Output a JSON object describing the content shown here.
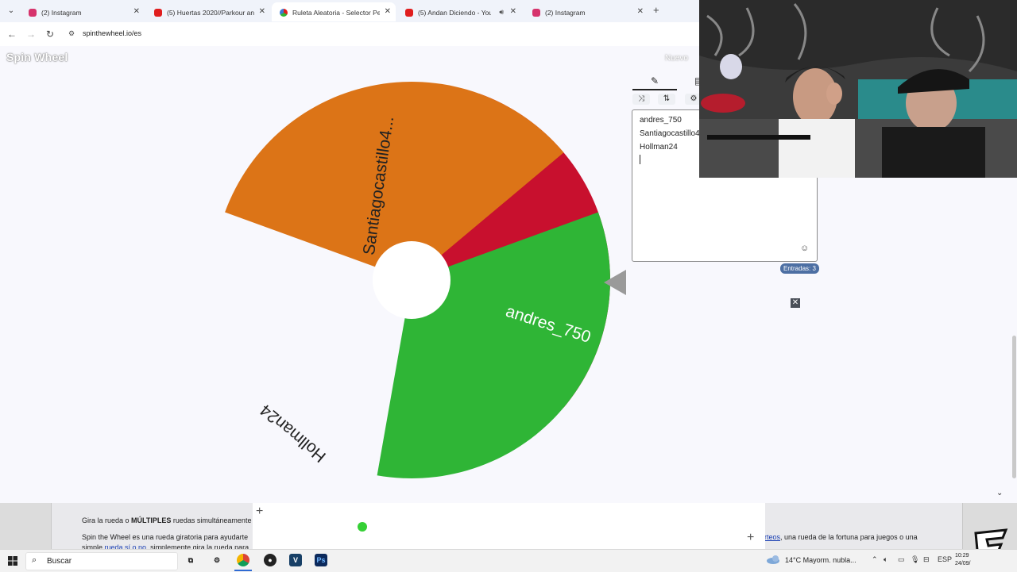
{
  "browser": {
    "tabs": [
      {
        "title": "(2) Instagram",
        "favicon": "instagram-icon",
        "color": "#d6336c"
      },
      {
        "title": "(5) Huertas 2020//Parkour and",
        "favicon": "youtube-icon",
        "color": "#e01e1e"
      },
      {
        "title": "Ruleta Aleatoria - Selector Pers",
        "favicon": "wheel-favicon",
        "color": "#3a7bd5",
        "active": true
      },
      {
        "title": "(5) Andan Diciendo - YouTu",
        "favicon": "youtube-icon",
        "color": "#e01e1e",
        "playing_audio": true
      },
      {
        "title": "(2) Instagram",
        "favicon": "instagram-icon",
        "color": "#d6336c"
      }
    ],
    "url": "spinthewheel.io/es"
  },
  "header": {
    "logo": "Spin Wheel",
    "new_button": "Nuevo"
  },
  "wheel": {
    "segments": [
      {
        "label": "andres_750",
        "color": "#c8102e"
      },
      {
        "label": "Hollman24",
        "color": "#2fb536"
      },
      {
        "label": "Santiagocastillo4...",
        "color": "#dc7417"
      }
    ]
  },
  "panel": {
    "tab_icons": [
      "pencil-icon",
      "list-icon"
    ],
    "tools": [
      "shuffle-icon",
      "sort-icon",
      "settings-icon"
    ],
    "entries": [
      "andres_750",
      "Santiagocastillo4",
      "Hollman24"
    ],
    "entries_count": "Entradas: 3"
  },
  "description": {
    "line1_pre": "Gira la rueda o ",
    "line1_bold": "MÚLTIPLES",
    "line1_post": " ruedas simultáneamente",
    "line2_pre": "Spin the Wheel es una rueda giratoria para ayudarte",
    "line2_link": "rteos",
    "line2_post": ", una rueda de la fortuna para juegos o una",
    "line3_pre": "simple ",
    "line3_link": "rueda sí o no",
    "line3_post": ", simplemente gira la rueda para"
  },
  "taskbar": {
    "search_placeholder": "Buscar",
    "weather": "14°C  Mayorm. nubla...",
    "language": "ESP",
    "time": "10:29",
    "date": "24/09/"
  }
}
